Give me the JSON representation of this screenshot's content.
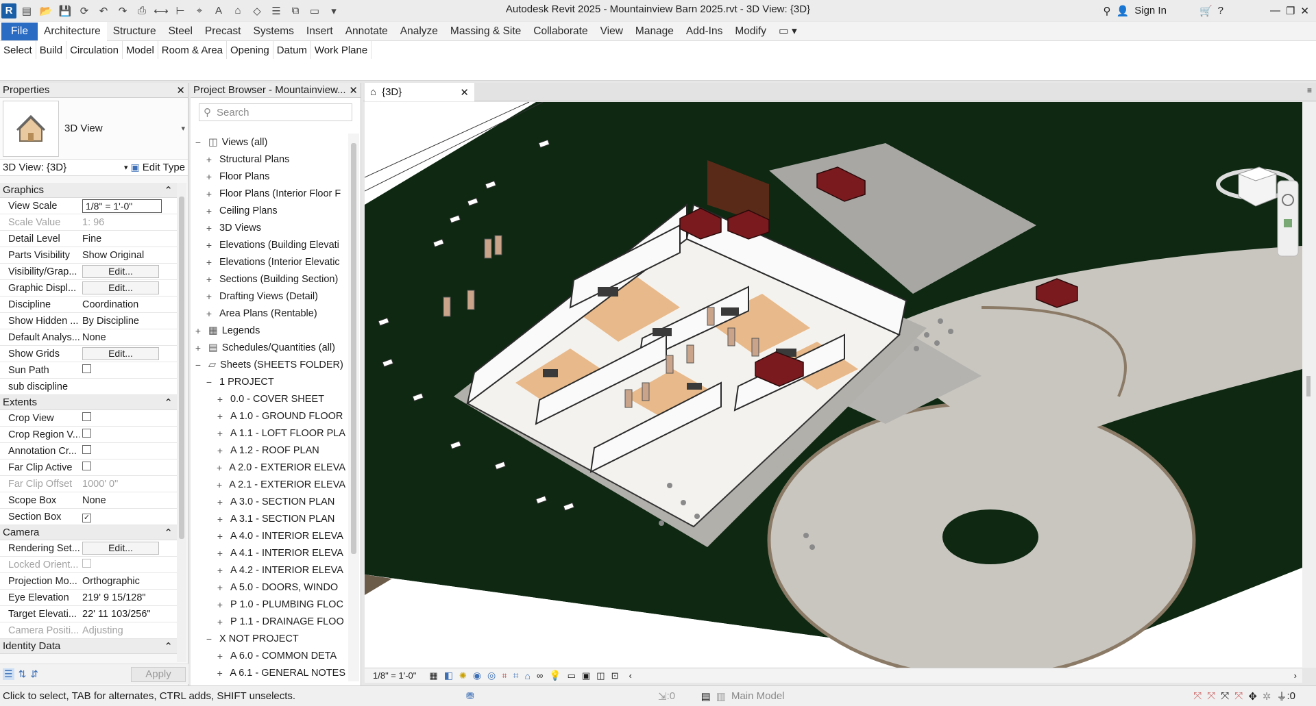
{
  "window": {
    "title": "Autodesk Revit 2025 - Mountainview Barn 2025.rvt - 3D View: {3D}",
    "sign_in": "Sign In",
    "logo": "R"
  },
  "menu": {
    "items": [
      "File",
      "Architecture",
      "Structure",
      "Steel",
      "Precast",
      "Systems",
      "Insert",
      "Annotate",
      "Analyze",
      "Massing & Site",
      "Collaborate",
      "View",
      "Manage",
      "Add-Ins",
      "Modify"
    ],
    "active": "Architecture"
  },
  "ribbon": {
    "panels": [
      "Select",
      "Build",
      "Circulation",
      "Model",
      "Room & Area",
      "Opening",
      "Datum",
      "Work Plane"
    ]
  },
  "properties": {
    "title": "Properties",
    "type_name": "3D View",
    "instance": "3D View: {3D}",
    "edit_type": "Edit Type",
    "sections": {
      "graphics": "Graphics",
      "extents": "Extents",
      "camera": "Camera",
      "identity": "Identity Data"
    },
    "graphics_rows": [
      {
        "k": "View Scale",
        "v": "1/8\" = 1'-0\""
      },
      {
        "k": "Scale Value",
        "v": "1:  96"
      },
      {
        "k": "Detail Level",
        "v": "Fine"
      },
      {
        "k": "Parts Visibility",
        "v": "Show Original"
      },
      {
        "k": "Visibility/Grap...",
        "v": "Edit..."
      },
      {
        "k": "Graphic Displ...",
        "v": "Edit..."
      },
      {
        "k": "Discipline",
        "v": "Coordination"
      },
      {
        "k": "Show Hidden ...",
        "v": "By Discipline"
      },
      {
        "k": "Default Analys...",
        "v": "None"
      },
      {
        "k": "Show Grids",
        "v": "Edit..."
      },
      {
        "k": "Sun Path",
        "v": ""
      },
      {
        "k": "sub discipline",
        "v": ""
      }
    ],
    "extents_rows": [
      {
        "k": "Crop View",
        "v": ""
      },
      {
        "k": "Crop Region V...",
        "v": ""
      },
      {
        "k": "Annotation Cr...",
        "v": ""
      },
      {
        "k": "Far Clip Active",
        "v": ""
      },
      {
        "k": "Far Clip Offset",
        "v": "1000'  0\""
      },
      {
        "k": "Scope Box",
        "v": "None"
      },
      {
        "k": "Section Box",
        "v": "✓"
      }
    ],
    "camera_rows": [
      {
        "k": "Rendering Set...",
        "v": "Edit..."
      },
      {
        "k": "Locked Orient...",
        "v": ""
      },
      {
        "k": "Projection Mo...",
        "v": "Orthographic"
      },
      {
        "k": "Eye Elevation",
        "v": "219'  9 15/128\""
      },
      {
        "k": "Target Elevati...",
        "v": "22'  11 103/256\""
      },
      {
        "k": "Camera Positi...",
        "v": "Adjusting"
      }
    ],
    "apply": "Apply"
  },
  "browser": {
    "title": "Project Browser - Mountainview...",
    "search_placeholder": "Search",
    "nodes": [
      {
        "t": "Views (all)",
        "lvl": 0,
        "tg": "−",
        "icon": "views"
      },
      {
        "t": "Structural Plans",
        "lvl": 1,
        "tg": "+"
      },
      {
        "t": "Floor Plans",
        "lvl": 1,
        "tg": "+"
      },
      {
        "t": "Floor Plans (Interior Floor F",
        "lvl": 1,
        "tg": "+"
      },
      {
        "t": "Ceiling Plans",
        "lvl": 1,
        "tg": "+"
      },
      {
        "t": "3D Views",
        "lvl": 1,
        "tg": "+"
      },
      {
        "t": "Elevations (Building Elevati",
        "lvl": 1,
        "tg": "+"
      },
      {
        "t": "Elevations (Interior Elevatic",
        "lvl": 1,
        "tg": "+"
      },
      {
        "t": "Sections (Building Section)",
        "lvl": 1,
        "tg": "+"
      },
      {
        "t": "Drafting Views (Detail)",
        "lvl": 1,
        "tg": "+"
      },
      {
        "t": "Area Plans (Rentable)",
        "lvl": 1,
        "tg": "+"
      },
      {
        "t": "Legends",
        "lvl": 0,
        "tg": "+",
        "icon": "legend"
      },
      {
        "t": "Schedules/Quantities (all)",
        "lvl": 0,
        "tg": "+",
        "icon": "schedule"
      },
      {
        "t": "Sheets (SHEETS FOLDER)",
        "lvl": 0,
        "tg": "−",
        "icon": "sheets"
      },
      {
        "t": "1 PROJECT",
        "lvl": 1,
        "tg": "−"
      },
      {
        "t": "0.0 - COVER SHEET",
        "lvl": 2,
        "tg": "+"
      },
      {
        "t": "A 1.0 - GROUND FLOOR",
        "lvl": 2,
        "tg": "+"
      },
      {
        "t": "A 1.1 - LOFT FLOOR PLA",
        "lvl": 2,
        "tg": "+"
      },
      {
        "t": "A 1.2 - ROOF PLAN",
        "lvl": 2,
        "tg": "+"
      },
      {
        "t": "A 2.0 - EXTERIOR ELEVA",
        "lvl": 2,
        "tg": "+"
      },
      {
        "t": "A 2.1 - EXTERIOR ELEVA",
        "lvl": 2,
        "tg": "+"
      },
      {
        "t": "A 3.0 - SECTION PLAN",
        "lvl": 2,
        "tg": "+"
      },
      {
        "t": "A 3.1 - SECTION PLAN",
        "lvl": 2,
        "tg": "+"
      },
      {
        "t": "A 4.0 - INTERIOR ELEVA",
        "lvl": 2,
        "tg": "+"
      },
      {
        "t": "A 4.1 - INTERIOR ELEVA",
        "lvl": 2,
        "tg": "+"
      },
      {
        "t": "A 4.2 - INTERIOR ELEVA",
        "lvl": 2,
        "tg": "+"
      },
      {
        "t": "A 5.0 - DOORS, WINDO",
        "lvl": 2,
        "tg": "+"
      },
      {
        "t": "P 1.0 - PLUMBING FLOC",
        "lvl": 2,
        "tg": "+"
      },
      {
        "t": "P 1.1 - DRAINAGE FLOO",
        "lvl": 2,
        "tg": "+"
      },
      {
        "t": "X NOT PROJECT",
        "lvl": 1,
        "tg": "−"
      },
      {
        "t": "A 6.0 - COMMON DETA",
        "lvl": 2,
        "tg": "+"
      },
      {
        "t": "A 6.1 - GENERAL NOTES",
        "lvl": 2,
        "tg": "+"
      }
    ]
  },
  "view": {
    "tab": "{3D}",
    "scale": "1/8\" = 1'-0\""
  },
  "status": {
    "hint": "Click to select, TAB for alternates, CTRL adds, SHIFT unselects.",
    "zero1": ":0",
    "model": "Main Model",
    "filter": ":0"
  },
  "colors": {
    "accent": "#2a6bc4",
    "grass": "#0f2a12",
    "drive": "#c9c6c0",
    "floor": "#e8b98a",
    "car": "#7a1a1e"
  }
}
